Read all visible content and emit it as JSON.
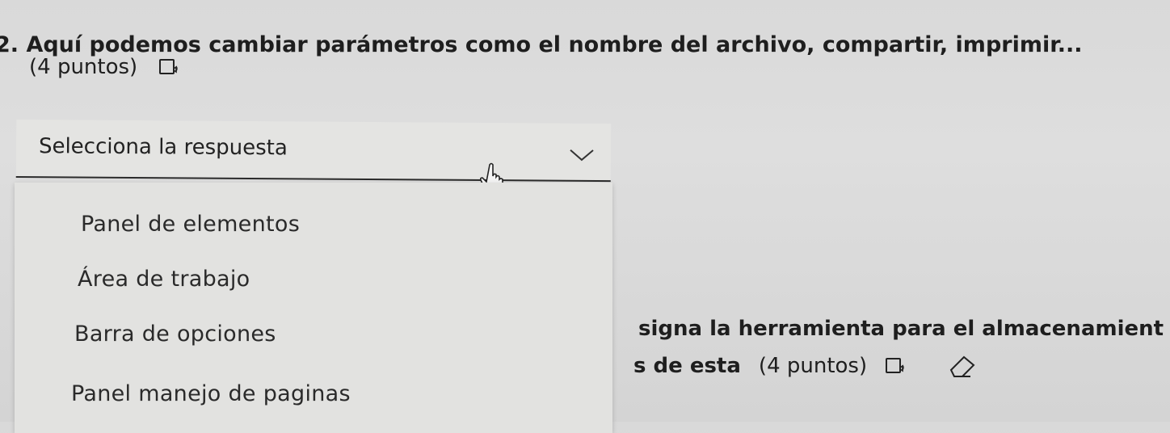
{
  "question": {
    "title": "2. Aquí podemos cambiar parámetros como el nombre del archivo, compartir, imprimir...",
    "points": "(4 puntos)",
    "icons": [
      "immersive-reader-icon"
    ]
  },
  "select": {
    "placeholder": "Selecciona la respuesta",
    "expanded": true,
    "icons": [
      "chevron-down-icon",
      "hand-cursor-icon"
    ]
  },
  "dropdown": {
    "options": [
      "Panel de elementos",
      "Área de trabajo",
      "Barra de opciones",
      "Panel manejo de paginas"
    ]
  },
  "next_question": {
    "line1_partial": "signa la herramienta para el almacenamient",
    "line2_partial_bold": "s de esta",
    "line2_points": "(4 puntos)",
    "icons": [
      "immersive-reader-icon",
      "eraser-icon"
    ]
  }
}
